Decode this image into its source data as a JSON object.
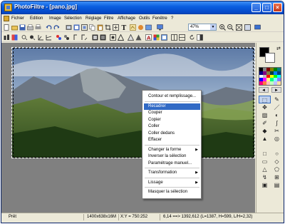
{
  "window": {
    "title": "PhotoFiltre - [pano.jpg]",
    "minimize_glyph": "_",
    "maximize_glyph": "□",
    "close_glyph": "×"
  },
  "menubar": {
    "items": [
      "Fichier",
      "Edition",
      "Image",
      "Sélection",
      "Réglage",
      "Filtre",
      "Affichage",
      "Outils",
      "Fenêtre",
      "?"
    ]
  },
  "toolbar": {
    "zoom_value": "47%",
    "zoom_arrow": "▼"
  },
  "palette": {
    "swap_glyph": "⇄",
    "prev": "◄",
    "next": "►",
    "colors": [
      "#000000",
      "#808080",
      "#800000",
      "#808000",
      "#008000",
      "#008080",
      "#000080",
      "#800080",
      "#808040",
      "#004040",
      "#0080ff",
      "#004080",
      "#ffffff",
      "#c0c0c0",
      "#ff0000",
      "#ffff00",
      "#00ff00",
      "#00ffff",
      "#0000ff",
      "#ff00ff",
      "#ffff80",
      "#00ff80",
      "#80ffff",
      "#8080ff",
      "#ff0080",
      "#ff8040",
      "#ffc0c0",
      "#c0ffc0",
      "#c0c0ff",
      "#ffe0a0"
    ]
  },
  "tools": {
    "items": [
      "⬚",
      "✎",
      "✥",
      "／",
      "▨",
      "◐",
      "✐",
      "∫",
      "◆",
      "✂",
      "▲",
      "◎"
    ],
    "shapes": [
      "□",
      "○",
      "▭",
      "◇",
      "△",
      "⬠",
      "↯",
      "⊞",
      "▣",
      "▤"
    ]
  },
  "context_menu": {
    "items": [
      {
        "label": "Contour et remplissage...",
        "submenu": false
      },
      {
        "label": "Recadrer",
        "submenu": false,
        "highlight": true
      },
      {
        "label": "Couper",
        "submenu": false
      },
      {
        "label": "Copier",
        "submenu": false
      },
      {
        "label": "Coller",
        "submenu": false
      },
      {
        "label": "Coller dedans",
        "submenu": false
      },
      {
        "label": "Effacer",
        "submenu": false
      },
      {
        "label": "Changer la forme",
        "submenu": true
      },
      {
        "label": "Inverser la sélection",
        "submenu": false
      },
      {
        "label": "Paramétrage manuel...",
        "submenu": false
      },
      {
        "label": "Transformation",
        "submenu": true
      },
      {
        "label": "Lissage",
        "submenu": true
      },
      {
        "label": "Masquer la sélection",
        "submenu": false
      }
    ]
  },
  "statusbar": {
    "state": "Prêt",
    "image_info": "1400x638x16M",
    "cursor": "X:Y = 750:252",
    "selection": "6,14 ==> 1392,612 (L=1387, H=599, L/H=2,32)"
  }
}
